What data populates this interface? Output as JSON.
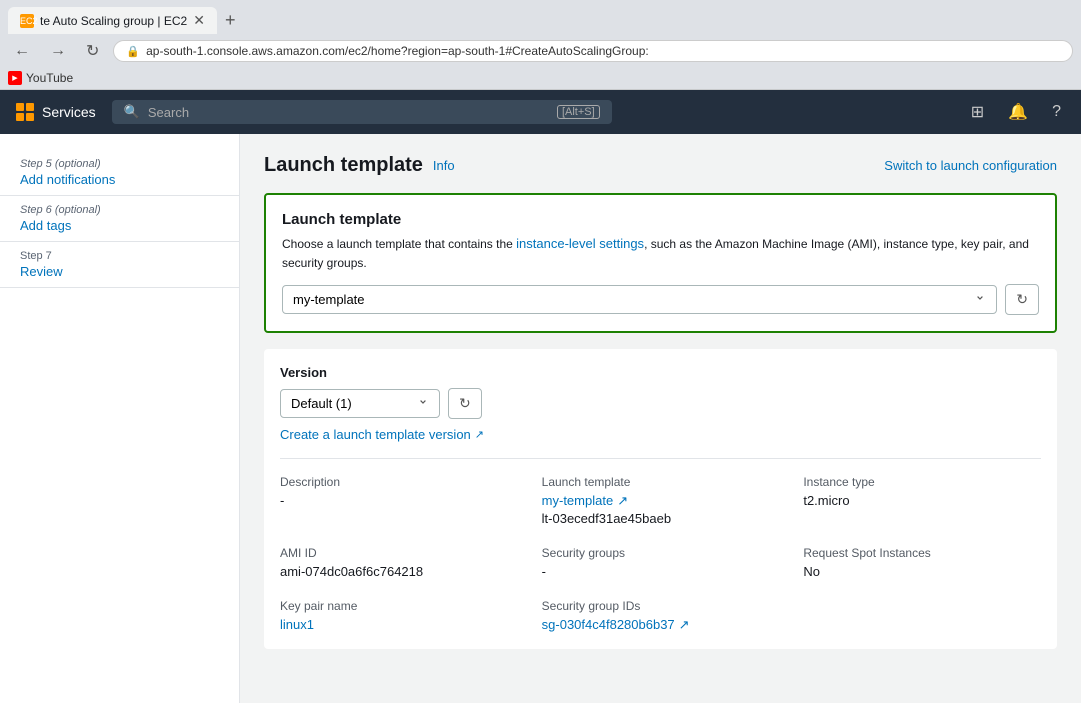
{
  "browser": {
    "tab_title": "te Auto Scaling group | EC2",
    "url": "ap-south-1.console.aws.amazon.com/ec2/home?region=ap-south-1#CreateAutoScalingGroup:",
    "new_tab_label": "+",
    "close_tab_label": "✕"
  },
  "bookmarks": [
    {
      "id": "youtube",
      "label": "YouTube"
    }
  ],
  "topnav": {
    "services_label": "Services",
    "search_placeholder": "Search",
    "search_shortcut": "[Alt+S]"
  },
  "sidebar": {
    "steps": [
      {
        "id": "step5",
        "label": "Step 5 (optional)",
        "name": "Add notifications"
      },
      {
        "id": "step6",
        "label": "Step 6 (optional)",
        "name": "Add tags"
      },
      {
        "id": "step7",
        "label": "Step 7",
        "name": "Review"
      }
    ]
  },
  "page": {
    "title": "Launch template",
    "info_label": "Info",
    "switch_label": "Switch to launch configuration",
    "launch_template_section": {
      "title": "Launch template",
      "description_parts": [
        "Choose a launch template that contains the ",
        "instance-level settings, such as the Amazon Machine Image (AMI), instance type, key pair, and security groups."
      ],
      "description_link_text": "instance-level settings",
      "template_dropdown_value": "my-template",
      "template_dropdown_options": [
        "my-template"
      ]
    },
    "version_section": {
      "label": "Version",
      "version_value": "Default (1)",
      "version_options": [
        "Default (1)"
      ],
      "create_link": "Create a launch template version",
      "create_link_icon": "↗"
    },
    "details": {
      "description": {
        "label": "Description",
        "value": "-"
      },
      "launch_template": {
        "label": "Launch template",
        "link_text": "my-template",
        "id_text": "lt-03ecedf31ae45baeb"
      },
      "instance_type": {
        "label": "Instance type",
        "value": "t2.micro"
      },
      "ami_id": {
        "label": "AMI ID",
        "value": "ami-074dc0a6f6c764218"
      },
      "security_groups": {
        "label": "Security groups",
        "value": "-"
      },
      "request_spot": {
        "label": "Request Spot Instances",
        "value": "No"
      },
      "key_pair": {
        "label": "Key pair name",
        "value": "linux1"
      },
      "security_group_ids": {
        "label": "Security group IDs",
        "link_text": "sg-030f4c4f8280b6b37",
        "link_icon": "↗"
      }
    }
  }
}
